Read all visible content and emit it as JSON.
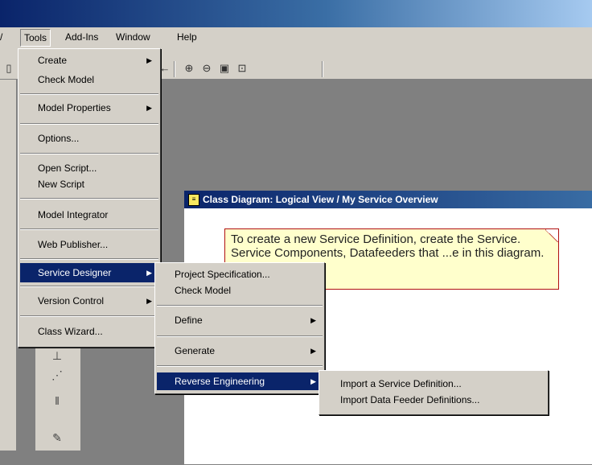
{
  "menubar": {
    "items": [
      {
        "label": "Tools"
      },
      {
        "label": "Add-Ins"
      },
      {
        "label": "Window"
      },
      {
        "label": "Help"
      }
    ]
  },
  "tools_menu": {
    "create": "Create",
    "check_model": "Check Model",
    "model_properties": "Model Properties",
    "options": "Options...",
    "open_script": "Open Script...",
    "new_script": "New Script",
    "model_integrator": "Model Integrator",
    "web_publisher": "Web Publisher...",
    "service_designer": "Service Designer",
    "version_control": "Version Control",
    "class_wizard": "Class Wizard..."
  },
  "service_designer_menu": {
    "project_specification": "Project Specification...",
    "check_model": "Check Model",
    "define": "Define",
    "generate": "Generate",
    "reverse_engineering": "Reverse Engineering"
  },
  "reverse_engineering_menu": {
    "import_service_definition": "Import a Service Definition...",
    "import_data_feeder": "Import Data Feeder Definitions..."
  },
  "diagram": {
    "title": "Class Diagram: Logical View / My Service Overview",
    "note_text": "To create a new Service Definition, create the Service. Service Components, Datafeeders that ...e in this diagram."
  },
  "colors": {
    "selection": "#0a246a",
    "menu_bg": "#d4d0c8",
    "note_bg": "#ffffcc",
    "note_border": "#b01010"
  }
}
